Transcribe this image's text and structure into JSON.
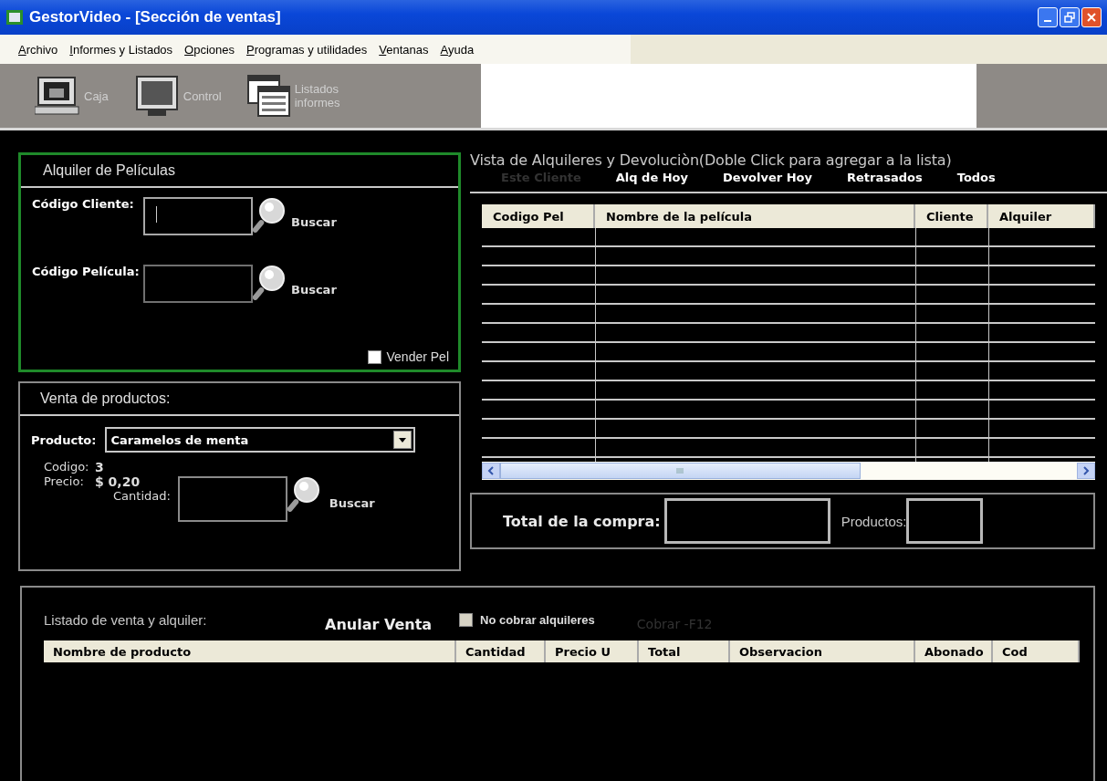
{
  "window": {
    "title": "GestorVideo - [Sección de ventas]"
  },
  "menu": [
    {
      "label": "Archivo"
    },
    {
      "label": "Informes y Listados"
    },
    {
      "label": "Opciones"
    },
    {
      "label": "Programas y utilidades"
    },
    {
      "label": "Ventanas"
    },
    {
      "label": "Ayuda"
    }
  ],
  "toolbar": [
    {
      "label": "Caja"
    },
    {
      "label": "Control"
    },
    {
      "label": "Listados informes"
    }
  ],
  "rental": {
    "title": "Alquiler de Películas",
    "fields": [
      {
        "label": "Código Cliente:",
        "button": "Buscar",
        "focused": true
      },
      {
        "label": "Código Película:",
        "button": "Buscar",
        "focused": false
      }
    ],
    "sell_checkbox": {
      "label": "Vender Pel",
      "checked": false
    }
  },
  "products": {
    "title": "Venta de productos:",
    "product_label": "Producto:",
    "product_value": "Caramelos de menta",
    "code_label": "Codigo:",
    "code": "3",
    "price_label": "Precio:",
    "price": "$ 0,20",
    "quantity_label": "Cantidad:",
    "search_button": "Buscar"
  },
  "rentals_view": {
    "title": "Vista de Alquileres y Devoluciòn(Doble Click para agregar a la lista)",
    "filters": [
      {
        "label": "Este Cliente",
        "disabled": true
      },
      {
        "label": "Alq de Hoy",
        "disabled": false
      },
      {
        "label": "Devolver Hoy",
        "disabled": false
      },
      {
        "label": "Retrasados",
        "disabled": false
      },
      {
        "label": "Todos",
        "disabled": false
      }
    ],
    "columns": [
      "Codigo Pel",
      "Nombre de la película",
      "Cliente",
      "Alquiler"
    ]
  },
  "totals": {
    "total_label": "Total de la compra:",
    "products_label": "Productos:"
  },
  "listing": {
    "title": "Listado de venta y alquiler:",
    "cancel_button": "Anular Venta",
    "no_charge": {
      "label": "No cobrar alquileres",
      "checked": false
    },
    "charge_button": {
      "label": "Cobrar -F12",
      "disabled": true
    },
    "columns": [
      "Nombre de producto",
      "Cantidad",
      "Precio U",
      "Total",
      "Observacion",
      "Abonado",
      "Cod"
    ]
  }
}
